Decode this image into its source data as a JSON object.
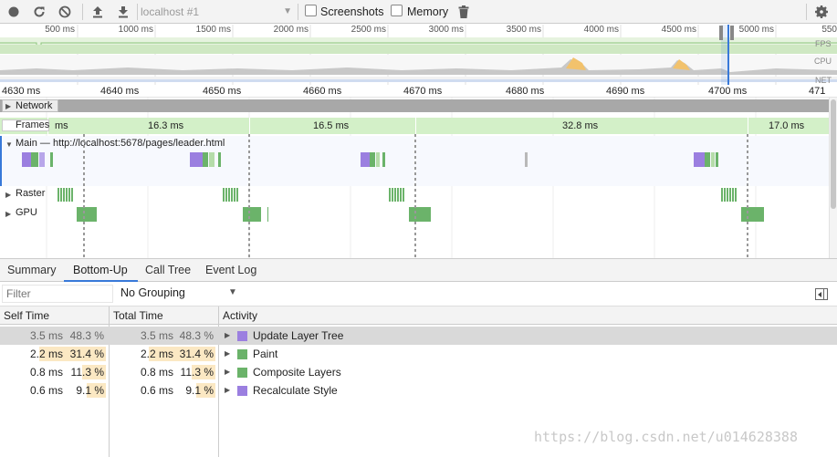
{
  "toolbar": {
    "profile_select": "localhost #1",
    "screenshots_label": "Screenshots",
    "memory_label": "Memory"
  },
  "overview": {
    "ticks": [
      "500 ms",
      "1000 ms",
      "1500 ms",
      "2000 ms",
      "2500 ms",
      "3000 ms",
      "3500 ms",
      "4000 ms",
      "4500 ms",
      "5000 ms",
      "550"
    ],
    "labels": {
      "fps": "FPS",
      "cpu": "CPU",
      "net": "NET"
    }
  },
  "detail_ruler": {
    "ticks": [
      "4630 ms",
      "4640 ms",
      "4650 ms",
      "4660 ms",
      "4670 ms",
      "4680 ms",
      "4690 ms",
      "4700 ms",
      "471"
    ]
  },
  "tracks": {
    "network": "Network",
    "frames": "Frames",
    "frames_cells": [
      "ms",
      "16.3 ms",
      "16.5 ms",
      "32.8 ms",
      "17.0 ms"
    ],
    "main": "Main — http://localhost:5678/pages/leader.html",
    "raster": "Raster",
    "gpu": "GPU"
  },
  "tabs": [
    "Summary",
    "Bottom-Up",
    "Call Tree",
    "Event Log"
  ],
  "selected_tab": "Bottom-Up",
  "filter": {
    "placeholder": "Filter",
    "grouping": "No Grouping"
  },
  "table": {
    "headers": {
      "self": "Self Time",
      "total": "Total Time",
      "activity": "Activity"
    },
    "rows": [
      {
        "self": "3.5 ms",
        "self_pct": "48.3 %",
        "total": "3.5 ms",
        "total_pct": "48.3 %",
        "activity": "Update Layer Tree",
        "color": "#9b7fe0",
        "pct": 48.3
      },
      {
        "self": "2.2 ms",
        "self_pct": "31.4 %",
        "total": "2.2 ms",
        "total_pct": "31.4 %",
        "activity": "Paint",
        "color": "#6bb36a",
        "pct": 31.4
      },
      {
        "self": "0.8 ms",
        "self_pct": "11.3 %",
        "total": "0.8 ms",
        "total_pct": "11.3 %",
        "activity": "Composite Layers",
        "color": "#6bb36a",
        "pct": 11.3
      },
      {
        "self": "0.6 ms",
        "self_pct": "9.1 %",
        "total": "0.6 ms",
        "total_pct": "9.1 %",
        "activity": "Recalculate Style",
        "color": "#9b7fe0",
        "pct": 9.1
      }
    ]
  },
  "watermark": "https://blog.csdn.net/u014628388",
  "colors": {
    "rendering": "#9b7fe0",
    "painting": "#6bb36a",
    "frames": "#d3f0c8",
    "accent": "#3879d9"
  }
}
